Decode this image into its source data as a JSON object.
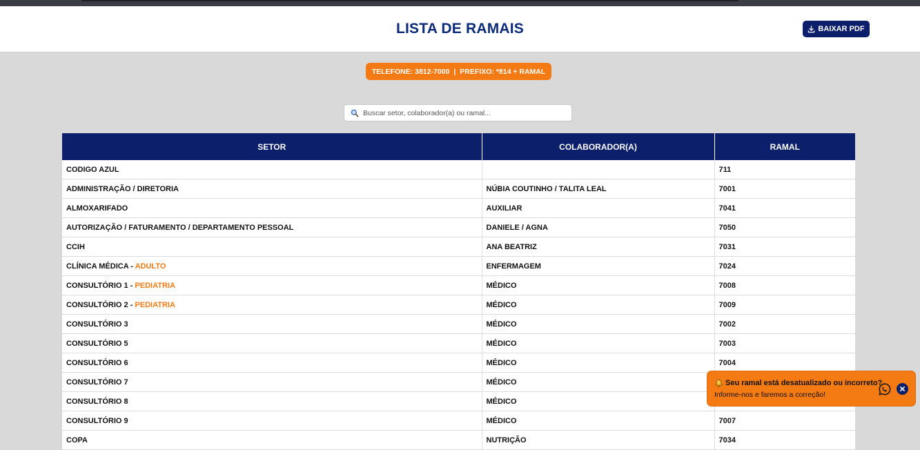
{
  "header": {
    "title": "LISTA DE RAMAIS",
    "pdf_button": "BAIXAR PDF"
  },
  "info": {
    "telefone": "TELEFONE: 3812-7000",
    "separator": "|",
    "prefixo": "PREFIXO: *814 + RAMAL"
  },
  "search": {
    "placeholder": "Buscar setor, colaborador(a) ou ramal...",
    "value": ""
  },
  "table": {
    "headers": [
      "SETOR",
      "COLABORADOR(A)",
      "RAMAL"
    ],
    "rows": [
      {
        "setor": "CODIGO AZUL",
        "highlight": "",
        "colaborador": "",
        "ramal": "711"
      },
      {
        "setor": "ADMINISTRAÇÃO / DIRETORIA",
        "highlight": "",
        "colaborador": "NÚBIA COUTINHO / TALITA LEAL",
        "ramal": "7001"
      },
      {
        "setor": "ALMOXARIFADO",
        "highlight": "",
        "colaborador": "AUXILIAR",
        "ramal": "7041"
      },
      {
        "setor": "AUTORIZAÇÃO / FATURAMENTO / DEPARTAMENTO PESSOAL",
        "highlight": "",
        "colaborador": "DANIELE / AGNA",
        "ramal": "7050"
      },
      {
        "setor": "CCIH",
        "highlight": "",
        "colaborador": "ANA BEATRIZ",
        "ramal": "7031"
      },
      {
        "setor": "CLÍNICA MÉDICA - ",
        "highlight": "ADULTO",
        "colaborador": "ENFERMAGEM",
        "ramal": "7024"
      },
      {
        "setor": "CONSULTÓRIO 1 - ",
        "highlight": "PEDIATRIA",
        "colaborador": "MÉDICO",
        "ramal": "7008"
      },
      {
        "setor": "CONSULTÓRIO 2 - ",
        "highlight": "PEDIATRIA",
        "colaborador": "MÉDICO",
        "ramal": "7009"
      },
      {
        "setor": "CONSULTÓRIO 3",
        "highlight": "",
        "colaborador": "MÉDICO",
        "ramal": "7002"
      },
      {
        "setor": "CONSULTÓRIO 5",
        "highlight": "",
        "colaborador": "MÉDICO",
        "ramal": "7003"
      },
      {
        "setor": "CONSULTÓRIO 6",
        "highlight": "",
        "colaborador": "MÉDICO",
        "ramal": "7004"
      },
      {
        "setor": "CONSULTÓRIO 7",
        "highlight": "",
        "colaborador": "MÉDICO",
        "ramal": ""
      },
      {
        "setor": "CONSULTÓRIO 8",
        "highlight": "",
        "colaborador": "MÉDICO",
        "ramal": ""
      },
      {
        "setor": "CONSULTÓRIO 9",
        "highlight": "",
        "colaborador": "MÉDICO",
        "ramal": "7007"
      },
      {
        "setor": "COPA",
        "highlight": "",
        "colaborador": "NUTRIÇÃO",
        "ramal": "7034"
      }
    ]
  },
  "toast": {
    "title": "Seu ramal está desatualizado ou incorreto?",
    "subtitle": "Informe-nos e faremos a correção!"
  },
  "colors": {
    "navy": "#0b1f6b",
    "orange": "#f47a14",
    "background": "#d9d9d9"
  },
  "icons": [
    "download-icon",
    "search-icon",
    "bell-icon",
    "whatsapp-icon",
    "close-icon"
  ]
}
